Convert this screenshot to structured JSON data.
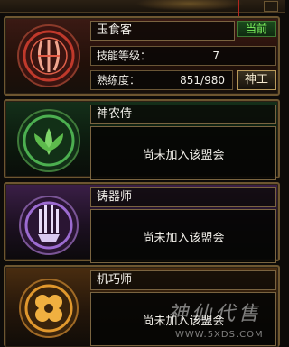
{
  "professions": [
    {
      "id": "yushike",
      "name": "玉食客",
      "badge": "当前",
      "skill_level_label": "技能等级：",
      "skill_level_value": "7",
      "proficiency_label": "熟练度：",
      "proficiency_value": "851/980",
      "action_button": "神工",
      "accent": "#c0392b"
    },
    {
      "id": "shennong",
      "name": "神农侍",
      "status": "尚未加入该盟会",
      "accent": "#4caf50"
    },
    {
      "id": "zhuqi",
      "name": "铸器师",
      "status": "尚未加入该盟会",
      "accent": "#9c6bd1"
    },
    {
      "id": "jiqiao",
      "name": "机巧师",
      "status": "尚未加入该盟会",
      "accent": "#e0982d"
    }
  ],
  "watermark": {
    "brand": "神仙代售",
    "url": "WWW.5XDS.COM"
  }
}
